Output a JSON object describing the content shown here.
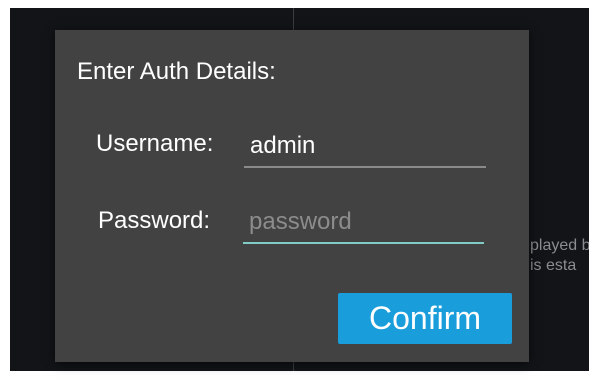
{
  "background": {
    "partial_text": [
      "played b",
      "is esta"
    ]
  },
  "dialog": {
    "title": "Enter Auth Details:",
    "username": {
      "label": "Username:",
      "value": "admin"
    },
    "password": {
      "label": "Password:",
      "value": "",
      "placeholder": "password"
    },
    "confirm_label": "Confirm"
  },
  "colors": {
    "dialog_background": "#424242",
    "app_background": "#121418",
    "accent_button": "#1a9ddb",
    "focused_underline": "#80cbc4"
  }
}
